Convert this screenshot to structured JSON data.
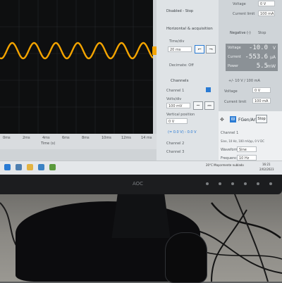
{
  "colors": {
    "trace": "#f4a400",
    "plot_background": "#0e0f10",
    "accent_blue": "#2a7bd4"
  },
  "plot": {
    "x_ticks": [
      "0ms",
      "2ms",
      "4ms",
      "6ms",
      "8ms",
      "10ms",
      "12ms",
      "14 ms"
    ],
    "x_axis_title": "Time (s)"
  },
  "scope_panel": {
    "disabled_label": "Disabled - Stop",
    "section_title": "Horizontal & acquisition",
    "time_div_label": "Time/div",
    "time_div_value": "20 ms",
    "decimate_label": "Decimate: Off",
    "channels_title": "Channels",
    "channel1_label": "Channel 1",
    "volts_div_label": "Volts/div",
    "volts_div_value": "100 mV",
    "offset_label": "Vertical position",
    "offset_value": "0 V",
    "channel_list_label": "(= 0.0 V) - 0.0 V",
    "channel2_label": "Channel 2",
    "channel3_label": "Channel 3"
  },
  "smu_panel": {
    "voltage_top_label": "Voltage",
    "voltage_top_value": "0 V",
    "current_limit_top_label": "Current limit",
    "current_limit_top_value": "100 mA",
    "negative_label": "Negative (-)",
    "stop_button": "Stop",
    "readouts": [
      {
        "name": "Voltage",
        "value": "-10.0",
        "unit": "V"
      },
      {
        "name": "Current",
        "value": "-553.6",
        "unit": "µA"
      },
      {
        "name": "Power",
        "value": "5.5",
        "unit": "mW"
      }
    ],
    "sub_label": "+/- 10 V / 100 mA",
    "voltage_label": "Voltage",
    "voltage_value": "0 V",
    "current_limit_label": "Current limit",
    "current_limit_value": "100 mA",
    "fgen_title": "FGen/Arb",
    "fgen_stop": "Stop",
    "fgen_channel": "Channel 1",
    "fgen_sub": "Sine, 10 Hz, 100 mVpp, 0 V DC",
    "waveform_label": "Waveform",
    "waveform_value": "Sine",
    "frequency_label": "Frequency",
    "frequency_value": "10 Hz"
  },
  "taskbar": {
    "weather": "20°C  Mayormente nublado",
    "time": "16:21",
    "date": "2/02/2023"
  },
  "monitor": {
    "brand": "AOC"
  }
}
